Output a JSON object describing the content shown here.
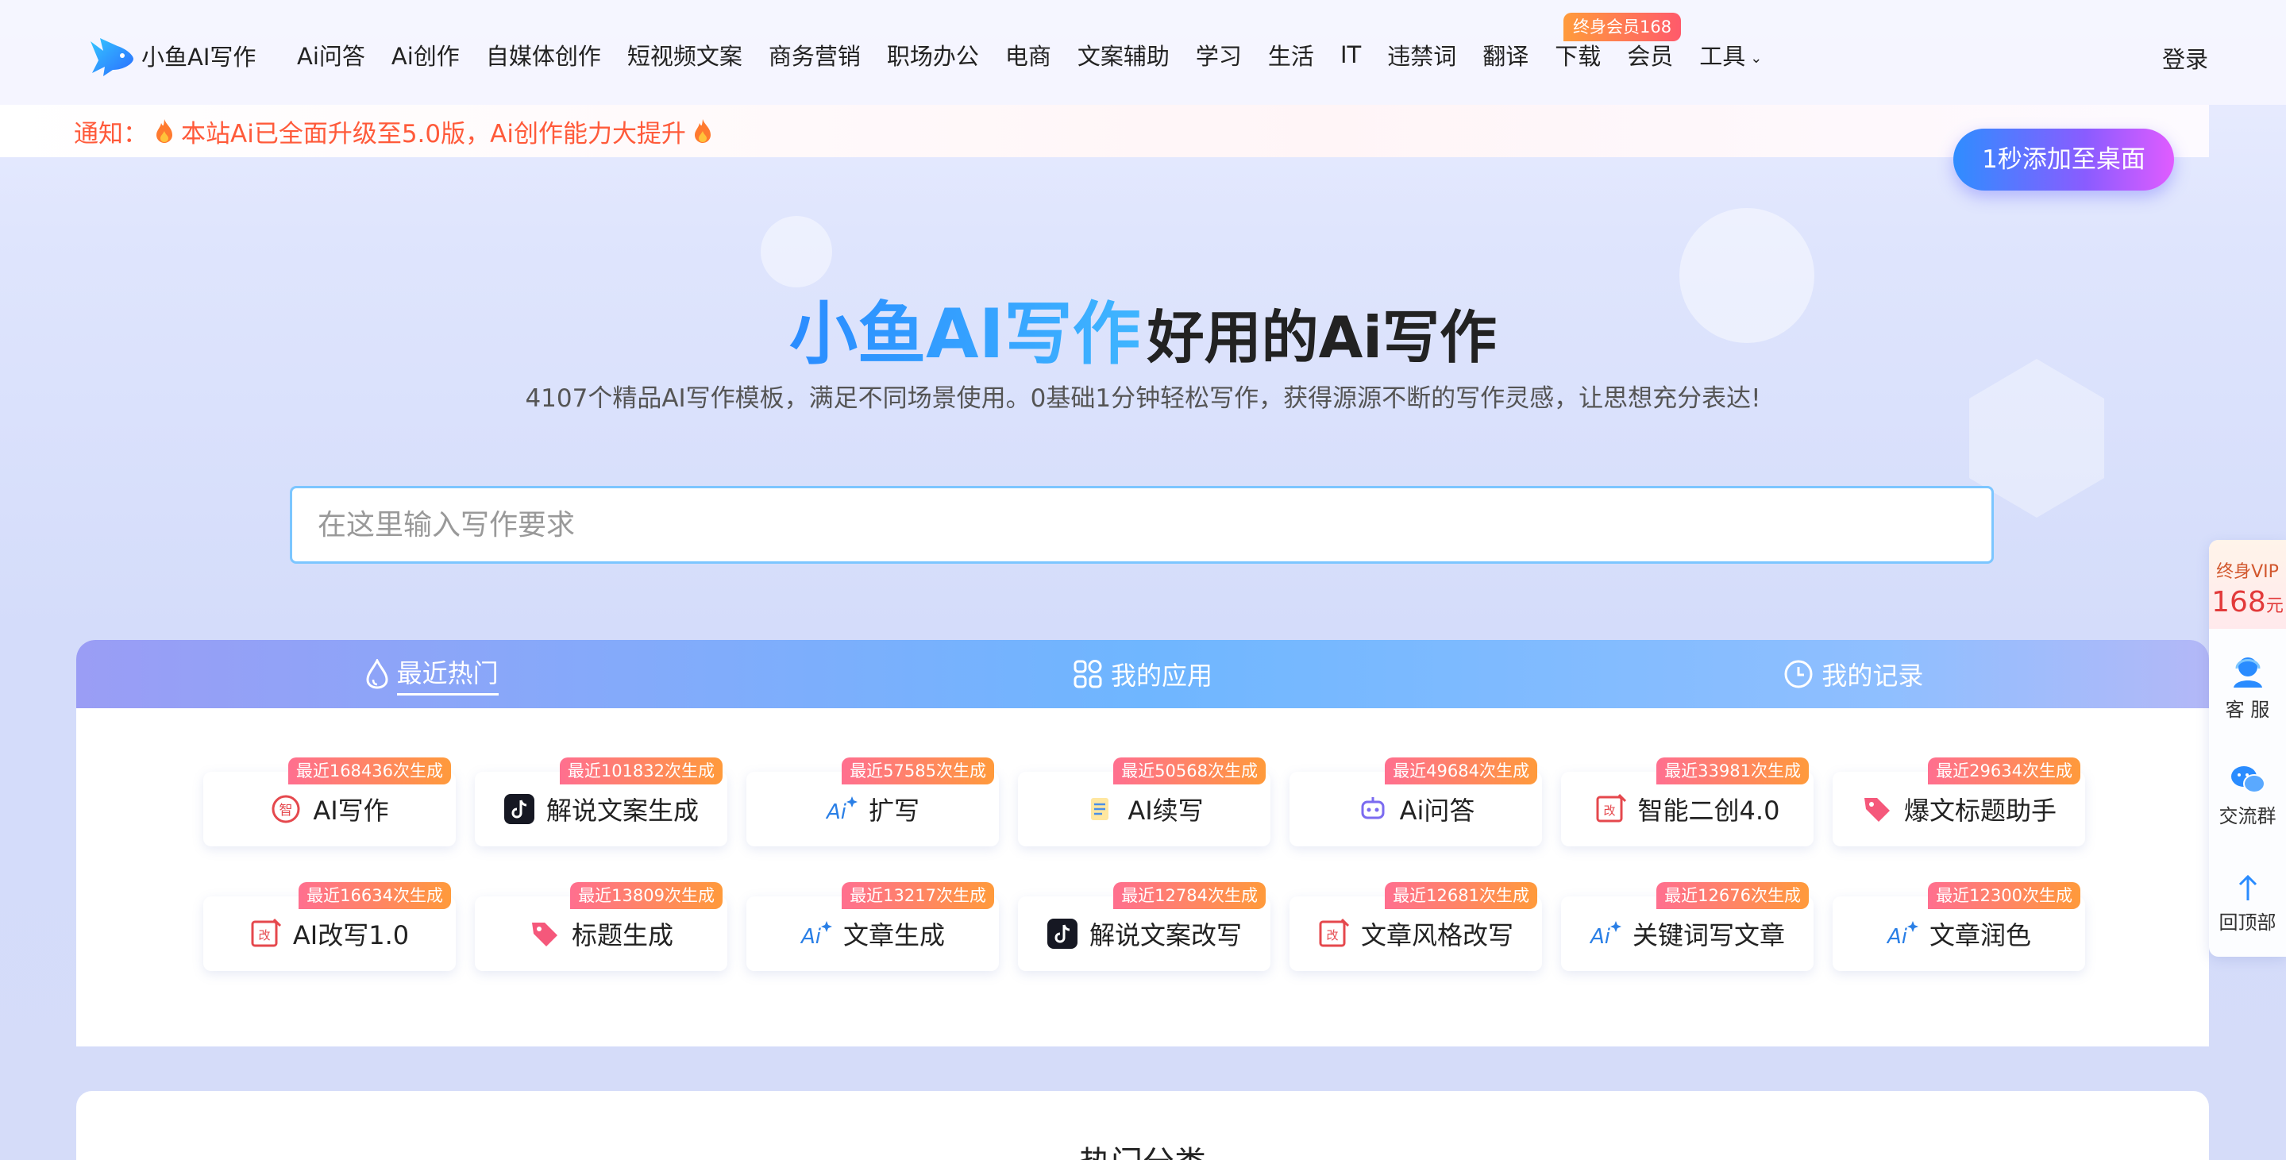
{
  "colors": {
    "brand_blue": "#2a8cff",
    "notice_red": "#ff5a3a",
    "badge_gradient_start": "#ff6f8f",
    "badge_gradient_end": "#ff9a3b"
  },
  "header": {
    "logo_text": "小鱼AI写作",
    "nav": [
      {
        "label": "Ai问答"
      },
      {
        "label": "Ai创作"
      },
      {
        "label": "自媒体创作"
      },
      {
        "label": "短视频文案"
      },
      {
        "label": "商务营销"
      },
      {
        "label": "职场办公"
      },
      {
        "label": "电商"
      },
      {
        "label": "文案辅助"
      },
      {
        "label": "学习"
      },
      {
        "label": "生活"
      },
      {
        "label": "IT"
      },
      {
        "label": "违禁词"
      },
      {
        "label": "翻译"
      },
      {
        "label": "下载"
      },
      {
        "label": "会员"
      },
      {
        "label": "工具"
      }
    ],
    "vip_tag": "终身会员168",
    "login": "登录"
  },
  "notice": {
    "label": "通知：",
    "text": "本站Ai已全面升级至5.0版，Ai创作能力大提升"
  },
  "add_desktop": "1秒添加至桌面",
  "hero": {
    "brand": "小鱼AI写作",
    "title_rest": "好用的Ai写作",
    "subtitle": "4107个精品AI写作模板，满足不同场景使用。0基础1分钟轻松写作，获得源源不断的写作灵感，让思想充分表达!"
  },
  "search": {
    "placeholder": "在这里输入写作要求"
  },
  "tabs": [
    {
      "label": "最近热门",
      "icon": "droplet-icon"
    },
    {
      "label": "我的应用",
      "icon": "grid-icon"
    },
    {
      "label": "我的记录",
      "icon": "clock-icon"
    }
  ],
  "cards_row1": [
    {
      "label": "AI写作",
      "badge": "最近168436次生成",
      "icon": "ai-write-icon"
    },
    {
      "label": "解说文案生成",
      "badge": "最近101832次生成",
      "icon": "tiktok-icon"
    },
    {
      "label": "扩写",
      "badge": "最近57585次生成",
      "icon": "ai-sparkle-icon"
    },
    {
      "label": "AI续写",
      "badge": "最近50568次生成",
      "icon": "notepad-icon"
    },
    {
      "label": "Ai问答",
      "badge": "最近49684次生成",
      "icon": "robot-icon"
    },
    {
      "label": "智能二创4.0",
      "badge": "最近33981次生成",
      "icon": "edit-box-icon"
    },
    {
      "label": "爆文标题助手",
      "badge": "最近29634次生成",
      "icon": "tag-icon"
    }
  ],
  "cards_row2": [
    {
      "label": "AI改写1.0",
      "badge": "最近16634次生成",
      "icon": "edit-box-icon"
    },
    {
      "label": "标题生成",
      "badge": "最近13809次生成",
      "icon": "tag-icon"
    },
    {
      "label": "文章生成",
      "badge": "最近13217次生成",
      "icon": "ai-sparkle-icon"
    },
    {
      "label": "解说文案改写",
      "badge": "最近12784次生成",
      "icon": "tiktok-icon"
    },
    {
      "label": "文章风格改写",
      "badge": "最近12681次生成",
      "icon": "edit-box-icon"
    },
    {
      "label": "关键词写文章",
      "badge": "最近12676次生成",
      "icon": "ai-sparkle-icon"
    },
    {
      "label": "文章润色",
      "badge": "最近12300次生成",
      "icon": "ai-sparkle-icon"
    }
  ],
  "hot_section_title": "热门分类",
  "sidebar": {
    "vip_top": "终身VIP",
    "vip_price": "168",
    "vip_unit": "元",
    "service": "客 服",
    "group": "交流群",
    "top": "回顶部"
  }
}
